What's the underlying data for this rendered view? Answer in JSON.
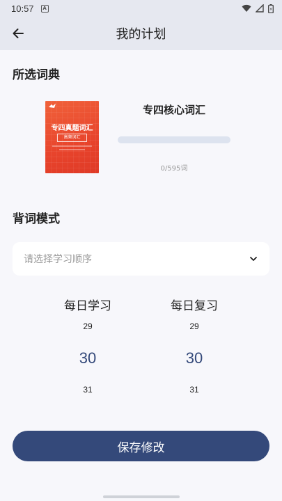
{
  "status_bar": {
    "time": "10:57",
    "notification_letter": "A"
  },
  "app_bar": {
    "title": "我的计划"
  },
  "dictionary_section": {
    "title": "所选词典",
    "book": {
      "name": "专四核心词汇",
      "cover_title": "专四真题词汇",
      "cover_subtitle": "高频词汇",
      "progress_text": "0/595词",
      "progress_fraction": 0
    }
  },
  "mode_section": {
    "title": "背词模式",
    "order_select": {
      "placeholder": "请选择学习顺序"
    }
  },
  "pickers": {
    "daily_study": {
      "label": "每日学习",
      "prev": "29",
      "selected": "30",
      "next": "31"
    },
    "daily_review": {
      "label": "每日复习",
      "prev": "29",
      "selected": "30",
      "next": "31"
    }
  },
  "save_button": {
    "label": "保存修改"
  },
  "colors": {
    "primary": "#34497a",
    "app_bar_bg": "#e6e8f0",
    "page_bg": "#f7f7fb",
    "cover_red": "#e8442c"
  }
}
